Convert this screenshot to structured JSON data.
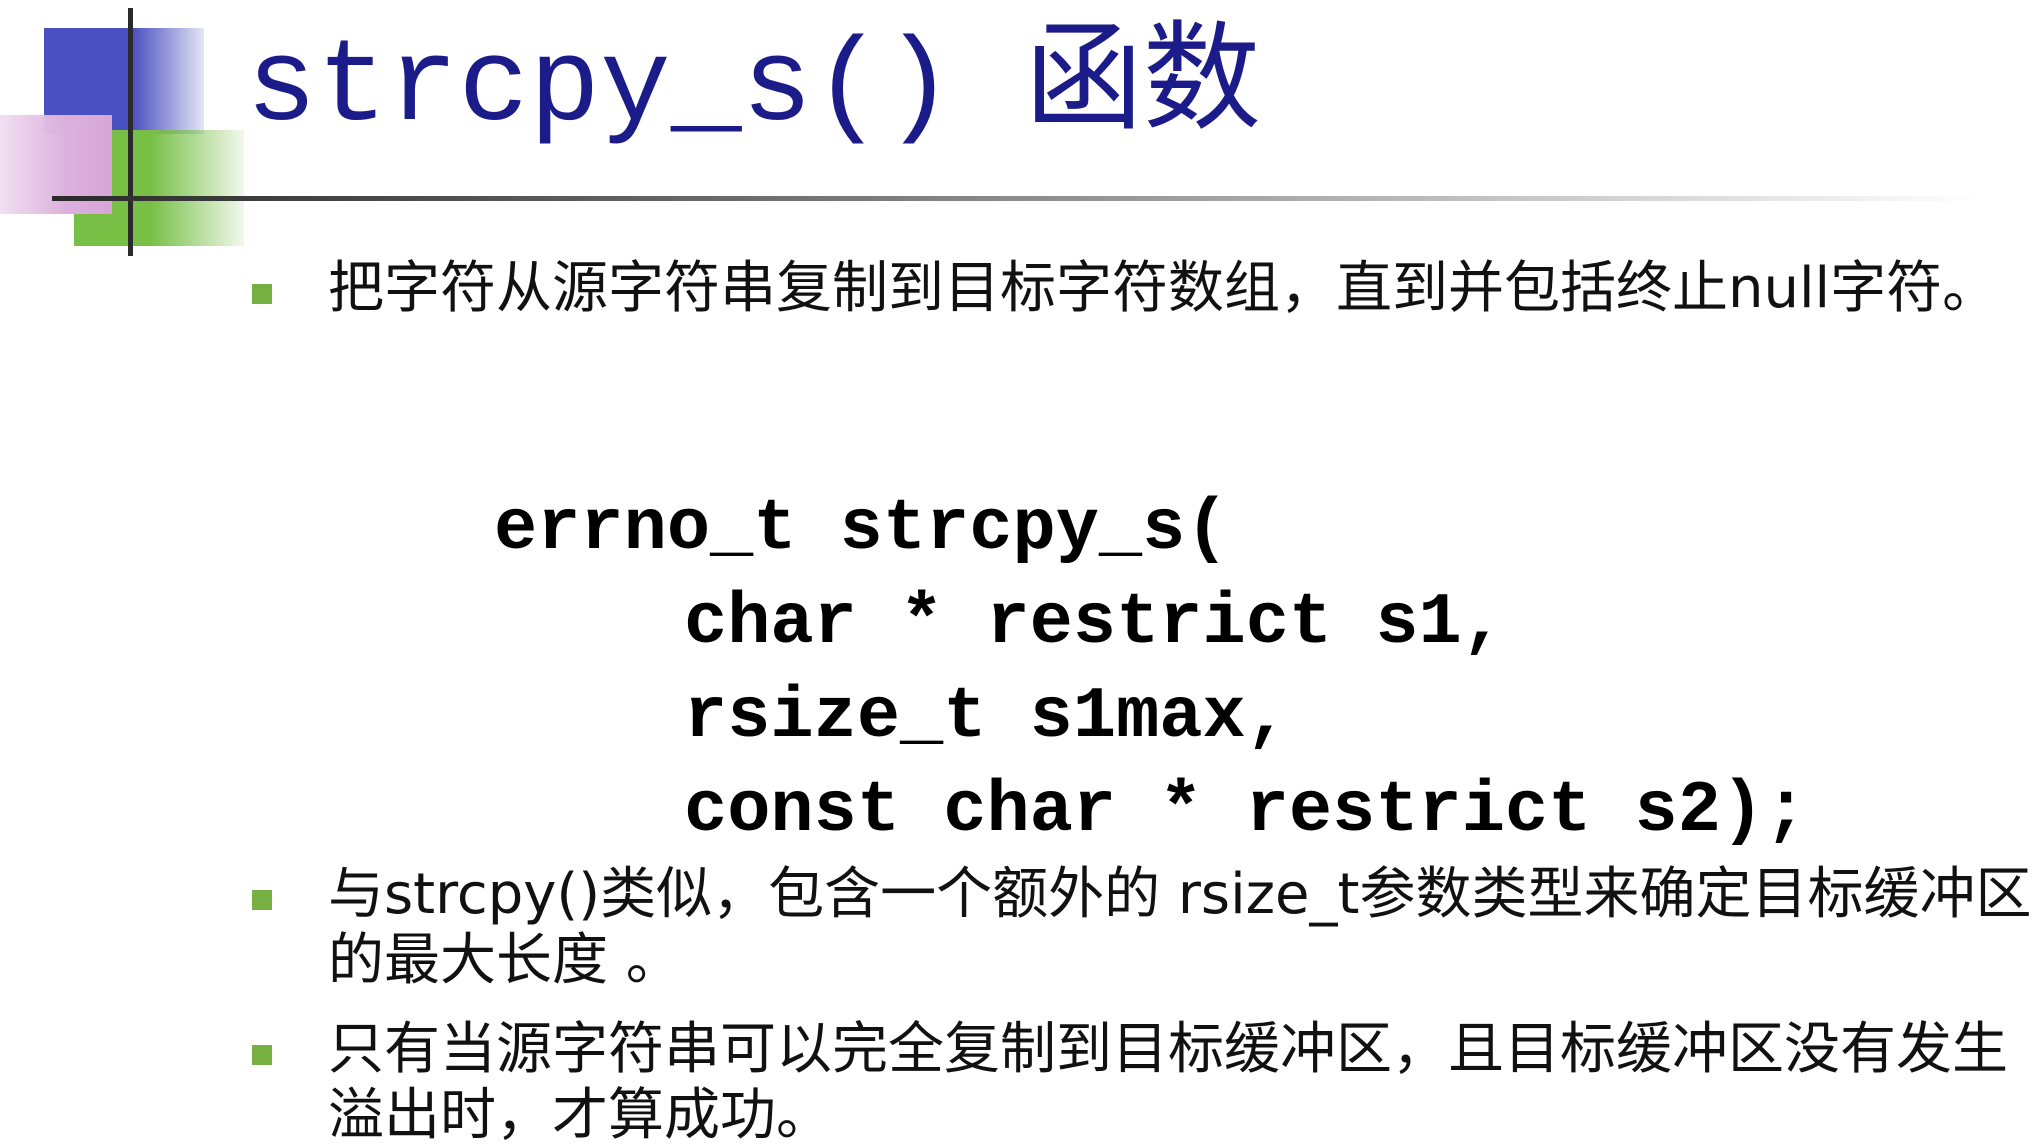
{
  "title": "strcpy_s() 函数",
  "bullets": [
    {
      "text": "把字符从源字符串复制到目标字符数组，直到并包括终止null字符。"
    },
    {
      "text": "与strcpy()类似，包含一个额外的 rsize_t参数类型来确定目标缓冲区的最大长度 。"
    },
    {
      "text": "只有当源字符串可以完全复制到目标缓冲区，且目标缓冲区没有发生溢出时，才算成功。"
    }
  ],
  "code": {
    "line1": "errno_t strcpy_s(",
    "line2": "char * restrict s1,",
    "line3": "rsize_t s1max,",
    "line4": "const char * restrict s2);"
  },
  "colors": {
    "title": "#1b1b8a",
    "bullet_marker": "#76b043",
    "deco_blue": "#4a4fc1",
    "deco_green": "#78bf46",
    "deco_pink": "#d7a6d7"
  }
}
